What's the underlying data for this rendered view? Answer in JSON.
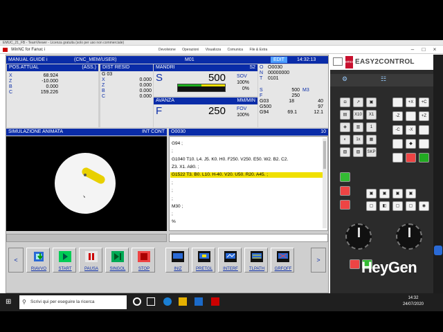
{
  "teamviewer_bar": "EMUC_21_FB - TeamViewer - Licenza gratuita (solo per uso non commerciale)",
  "window_title": "WinNC for Fanuc i",
  "tv_toolbar": [
    "Devolvione",
    "Operazioni",
    "Visualizza",
    "Comunica",
    "File & Extra"
  ],
  "manual": {
    "mode": "MANUAL GUIDE i",
    "prog": "(CNC_MEM/USER)",
    "program_o": "M01",
    "edit": "EDIT",
    "time": "14:32:13"
  },
  "pos": {
    "title": "POS.ATTUAL",
    "mode": "(ASS.)",
    "axes": [
      {
        "axis": "X",
        "value": "68.924"
      },
      {
        "axis": "Z",
        "value": "-10.000"
      },
      {
        "axis": "B",
        "value": "0.000"
      },
      {
        "axis": "C",
        "value": "159.226"
      }
    ]
  },
  "dist": {
    "title": "DIST RESID",
    "g": "G 03",
    "axes": [
      {
        "axis": "X",
        "value": "0.000"
      },
      {
        "axis": "Z",
        "value": "0.000"
      },
      {
        "axis": "B",
        "value": "0.000"
      },
      {
        "axis": "C",
        "value": "0.000"
      }
    ]
  },
  "mandrino": {
    "title": "MANDRI",
    "unit": "S2",
    "letter": "S",
    "value": "500",
    "sov_label": "SOV",
    "sov": "100%",
    "pct": "0%"
  },
  "avanz": {
    "title": "AVANZA",
    "unit": "MM/MIN",
    "letter": "F",
    "value": "250",
    "fov_label": "FOV",
    "fov": "100%"
  },
  "status": {
    "o_label": "O",
    "o": "O0030",
    "n_label": "N",
    "n": "00000000",
    "t_label": "T",
    "t": "0101",
    "s_label": "S",
    "s": "500",
    "m": "M3",
    "f_label": "F",
    "f": "250",
    "g1": "G03",
    "g1_a": "18",
    "g1_b": "40",
    "g2": "G500",
    "g2_b": "97",
    "g3": "G94",
    "g3_a": "69.1",
    "g3_b": "12.1"
  },
  "sim": {
    "title": "SIMULAZIONE ANIMATA",
    "right": "INT CONT"
  },
  "program": {
    "name": "O0030",
    "num": "10",
    "lines": [
      "G94 ;",
      ";",
      "G1040 T10. L4. J5. K0. H0. F250. V250. E50. W2. B2. C2.",
      "Z3. X1. A80. ;",
      "G1522 T3. B0. L10. H-40. V20. U50. R20. A45. ;",
      ";",
      ";",
      ";",
      "M30 ;",
      ";",
      "%"
    ],
    "highlight_index": 4
  },
  "softkeys": [
    {
      "label": "RIAVVO",
      "icon": "reset-icon"
    },
    {
      "label": "START",
      "icon": "play-icon"
    },
    {
      "label": "PAUSA",
      "icon": "pause-icon"
    },
    {
      "label": "SINGOL",
      "icon": "single-block-icon"
    },
    {
      "label": "STOP",
      "icon": "stop-icon"
    },
    {
      "label": "INIZ",
      "icon": "init-icon"
    },
    {
      "label": "PRETGL",
      "icon": "pretool-icon"
    },
    {
      "label": "INTERF",
      "icon": "interference-icon"
    },
    {
      "label": "TLPATH",
      "icon": "toolpath-icon"
    },
    {
      "label": "GRFOFF",
      "icon": "graphic-off-icon"
    }
  ],
  "emco": {
    "logo": "emco",
    "brand": "EASY2CONTROL",
    "keys": [
      "+X",
      "+C",
      "-Z",
      "+Z",
      "-C",
      "-X",
      "1",
      "1x",
      "X1",
      "X10",
      "SKP"
    ],
    "colors": {
      "brand_red": "#c8102e",
      "panel": "#2b2b2b"
    }
  },
  "watermark": "HeyGen",
  "taskbar": {
    "search": "Scrivi qui per eseguire la ricerca",
    "time": "14:32",
    "date": "24/07/2020"
  },
  "colors": {
    "blue": "#0a2ca8",
    "highlight": "#f0e000",
    "spindle_red": "#e01010"
  }
}
